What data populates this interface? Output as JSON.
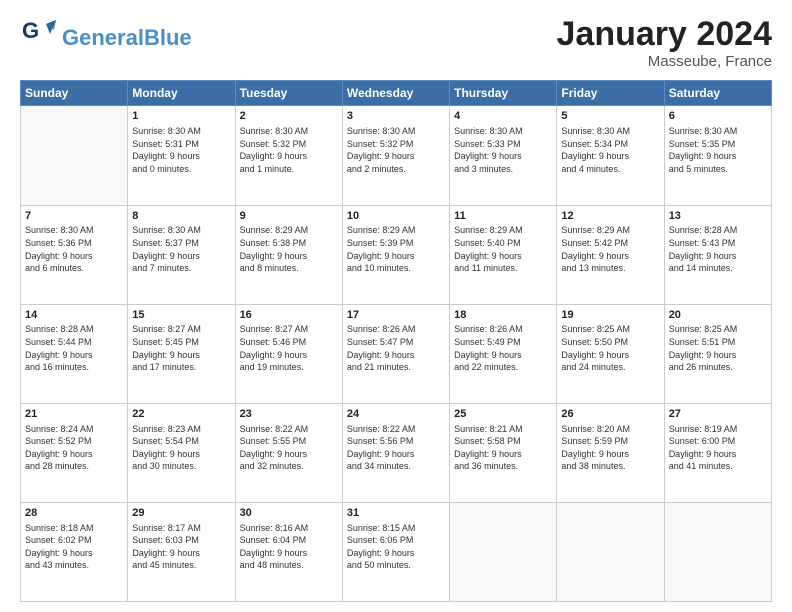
{
  "header": {
    "logo_general": "General",
    "logo_blue": "Blue",
    "month_title": "January 2024",
    "location": "Masseube, France"
  },
  "weekdays": [
    "Sunday",
    "Monday",
    "Tuesday",
    "Wednesday",
    "Thursday",
    "Friday",
    "Saturday"
  ],
  "weeks": [
    [
      {
        "day": "",
        "info": ""
      },
      {
        "day": "1",
        "info": "Sunrise: 8:30 AM\nSunset: 5:31 PM\nDaylight: 9 hours\nand 0 minutes."
      },
      {
        "day": "2",
        "info": "Sunrise: 8:30 AM\nSunset: 5:32 PM\nDaylight: 9 hours\nand 1 minute."
      },
      {
        "day": "3",
        "info": "Sunrise: 8:30 AM\nSunset: 5:32 PM\nDaylight: 9 hours\nand 2 minutes."
      },
      {
        "day": "4",
        "info": "Sunrise: 8:30 AM\nSunset: 5:33 PM\nDaylight: 9 hours\nand 3 minutes."
      },
      {
        "day": "5",
        "info": "Sunrise: 8:30 AM\nSunset: 5:34 PM\nDaylight: 9 hours\nand 4 minutes."
      },
      {
        "day": "6",
        "info": "Sunrise: 8:30 AM\nSunset: 5:35 PM\nDaylight: 9 hours\nand 5 minutes."
      }
    ],
    [
      {
        "day": "7",
        "info": "Sunrise: 8:30 AM\nSunset: 5:36 PM\nDaylight: 9 hours\nand 6 minutes."
      },
      {
        "day": "8",
        "info": "Sunrise: 8:30 AM\nSunset: 5:37 PM\nDaylight: 9 hours\nand 7 minutes."
      },
      {
        "day": "9",
        "info": "Sunrise: 8:29 AM\nSunset: 5:38 PM\nDaylight: 9 hours\nand 8 minutes."
      },
      {
        "day": "10",
        "info": "Sunrise: 8:29 AM\nSunset: 5:39 PM\nDaylight: 9 hours\nand 10 minutes."
      },
      {
        "day": "11",
        "info": "Sunrise: 8:29 AM\nSunset: 5:40 PM\nDaylight: 9 hours\nand 11 minutes."
      },
      {
        "day": "12",
        "info": "Sunrise: 8:29 AM\nSunset: 5:42 PM\nDaylight: 9 hours\nand 13 minutes."
      },
      {
        "day": "13",
        "info": "Sunrise: 8:28 AM\nSunset: 5:43 PM\nDaylight: 9 hours\nand 14 minutes."
      }
    ],
    [
      {
        "day": "14",
        "info": "Sunrise: 8:28 AM\nSunset: 5:44 PM\nDaylight: 9 hours\nand 16 minutes."
      },
      {
        "day": "15",
        "info": "Sunrise: 8:27 AM\nSunset: 5:45 PM\nDaylight: 9 hours\nand 17 minutes."
      },
      {
        "day": "16",
        "info": "Sunrise: 8:27 AM\nSunset: 5:46 PM\nDaylight: 9 hours\nand 19 minutes."
      },
      {
        "day": "17",
        "info": "Sunrise: 8:26 AM\nSunset: 5:47 PM\nDaylight: 9 hours\nand 21 minutes."
      },
      {
        "day": "18",
        "info": "Sunrise: 8:26 AM\nSunset: 5:49 PM\nDaylight: 9 hours\nand 22 minutes."
      },
      {
        "day": "19",
        "info": "Sunrise: 8:25 AM\nSunset: 5:50 PM\nDaylight: 9 hours\nand 24 minutes."
      },
      {
        "day": "20",
        "info": "Sunrise: 8:25 AM\nSunset: 5:51 PM\nDaylight: 9 hours\nand 26 minutes."
      }
    ],
    [
      {
        "day": "21",
        "info": "Sunrise: 8:24 AM\nSunset: 5:52 PM\nDaylight: 9 hours\nand 28 minutes."
      },
      {
        "day": "22",
        "info": "Sunrise: 8:23 AM\nSunset: 5:54 PM\nDaylight: 9 hours\nand 30 minutes."
      },
      {
        "day": "23",
        "info": "Sunrise: 8:22 AM\nSunset: 5:55 PM\nDaylight: 9 hours\nand 32 minutes."
      },
      {
        "day": "24",
        "info": "Sunrise: 8:22 AM\nSunset: 5:56 PM\nDaylight: 9 hours\nand 34 minutes."
      },
      {
        "day": "25",
        "info": "Sunrise: 8:21 AM\nSunset: 5:58 PM\nDaylight: 9 hours\nand 36 minutes."
      },
      {
        "day": "26",
        "info": "Sunrise: 8:20 AM\nSunset: 5:59 PM\nDaylight: 9 hours\nand 38 minutes."
      },
      {
        "day": "27",
        "info": "Sunrise: 8:19 AM\nSunset: 6:00 PM\nDaylight: 9 hours\nand 41 minutes."
      }
    ],
    [
      {
        "day": "28",
        "info": "Sunrise: 8:18 AM\nSunset: 6:02 PM\nDaylight: 9 hours\nand 43 minutes."
      },
      {
        "day": "29",
        "info": "Sunrise: 8:17 AM\nSunset: 6:03 PM\nDaylight: 9 hours\nand 45 minutes."
      },
      {
        "day": "30",
        "info": "Sunrise: 8:16 AM\nSunset: 6:04 PM\nDaylight: 9 hours\nand 48 minutes."
      },
      {
        "day": "31",
        "info": "Sunrise: 8:15 AM\nSunset: 6:06 PM\nDaylight: 9 hours\nand 50 minutes."
      },
      {
        "day": "",
        "info": ""
      },
      {
        "day": "",
        "info": ""
      },
      {
        "day": "",
        "info": ""
      }
    ]
  ]
}
